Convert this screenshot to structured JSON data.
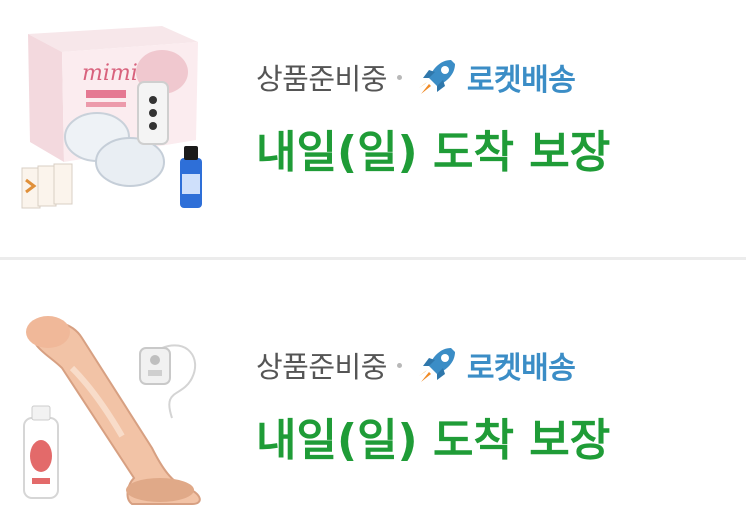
{
  "products": [
    {
      "status": "상품준비중",
      "delivery_badge": "로켓배송",
      "delivery_icon": "rocket-icon",
      "arrival": "내일(일) 도착 보장",
      "thumbnail_text": "mimi"
    },
    {
      "status": "상품준비중",
      "delivery_badge": "로켓배송",
      "delivery_icon": "rocket-icon",
      "arrival": "내일(일) 도착 보장"
    }
  ],
  "colors": {
    "status": "#555555",
    "rocket": "#3b8dc6",
    "arrival": "#1f9c37",
    "divider": "#ececec"
  }
}
